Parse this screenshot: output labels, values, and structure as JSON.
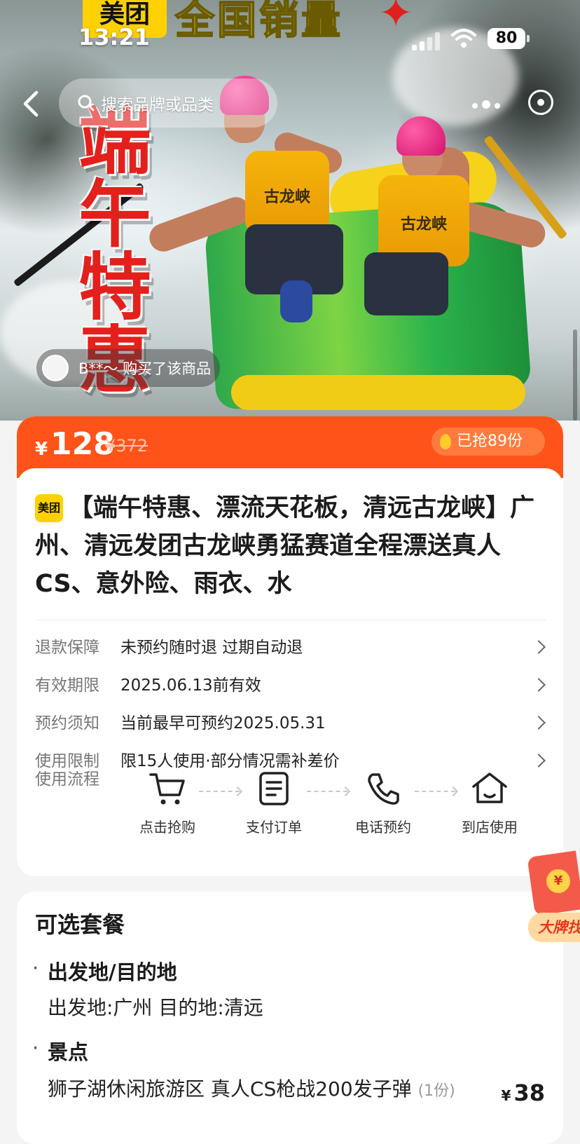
{
  "status_bar": {
    "time": "13:21",
    "battery": "80"
  },
  "hero": {
    "brand_tag": "美团",
    "banner_text": "全国销量",
    "vertical_title": "端午特惠",
    "vest_text": "古龙峡",
    "buyer_notice": "B**～ 购买了该商品"
  },
  "nav": {
    "search_placeholder": "搜索品牌或品类"
  },
  "price": {
    "currency": "¥",
    "current": "128",
    "original": "¥372",
    "sold": "已抢89份"
  },
  "product": {
    "badge": "美团",
    "title": "【端午特惠、漂流天花板，清远古龙峡】广州、清远发团古龙峡勇猛赛道全程漂送真人CS、意外险、雨衣、水"
  },
  "info_rows": [
    {
      "label": "退款保障",
      "value": "未预约随时退 过期自动退"
    },
    {
      "label": "有效期限",
      "value": "2025.06.13前有效"
    },
    {
      "label": "预约须知",
      "value": "当前最早可预约2025.05.31"
    },
    {
      "label": "使用限制",
      "value": "限15人使用·部分情况需补差价"
    }
  ],
  "flow": {
    "label": "使用流程",
    "steps": [
      {
        "label": "点击抢购",
        "icon": "cart-icon"
      },
      {
        "label": "支付订单",
        "icon": "document-icon"
      },
      {
        "label": "电话预约",
        "icon": "phone-icon"
      },
      {
        "label": "到店使用",
        "icon": "home-icon"
      }
    ]
  },
  "packages": {
    "heading": "可选套餐",
    "sections": [
      {
        "title": "出发地/目的地",
        "body": "出发地:广州 目的地:清远"
      },
      {
        "title": "景点",
        "body": "狮子湖休闲旅游区 真人CS枪战200发子弹",
        "qty": "(1份)",
        "price": "38",
        "currency": "¥"
      }
    ]
  },
  "red_packet": {
    "coin": "¥",
    "label": "大牌找"
  },
  "colors": {
    "accent": "#ff5319",
    "brand_yellow": "#ffd100",
    "helmet_pink": "#e0197a"
  }
}
